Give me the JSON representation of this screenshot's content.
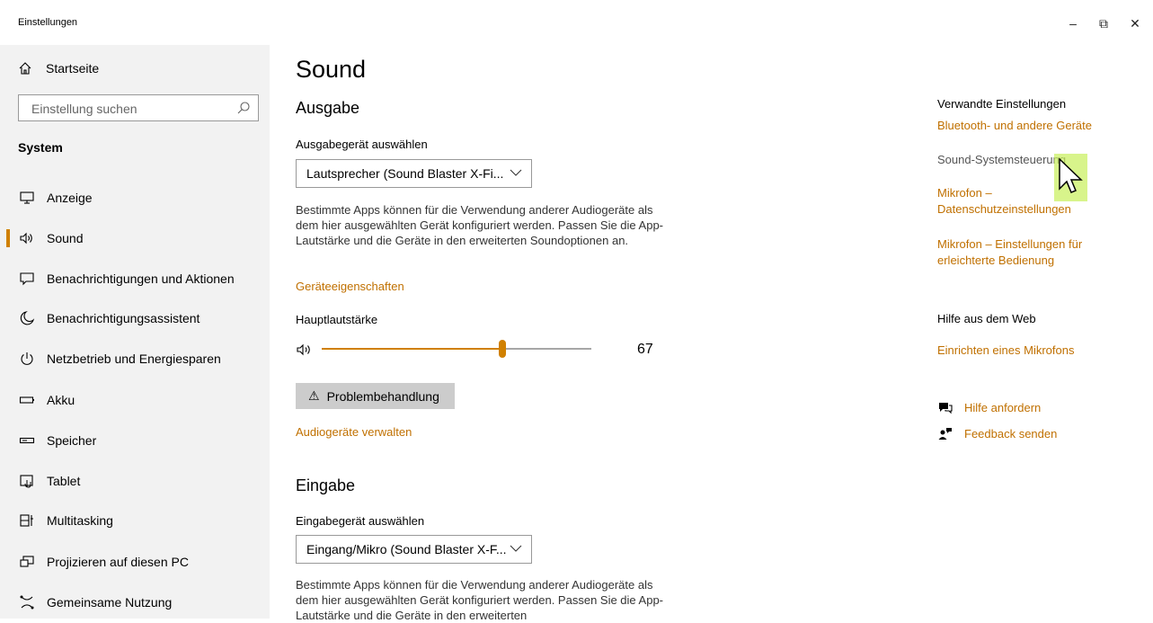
{
  "window": {
    "title": "Einstellungen",
    "minimize": "–",
    "maximize": "⧉",
    "close": "✕"
  },
  "sidebar": {
    "home_label": "Startseite",
    "search_placeholder": "Einstellung suchen",
    "section_heading": "System",
    "items": [
      {
        "label": "Anzeige",
        "icon": "monitor-icon"
      },
      {
        "label": "Sound",
        "icon": "speaker-icon",
        "active": true
      },
      {
        "label": "Benachrichtigungen und Aktionen",
        "icon": "notification-icon"
      },
      {
        "label": "Benachrichtigungsassistent",
        "icon": "moon-icon"
      },
      {
        "label": "Netzbetrieb und Energiesparen",
        "icon": "power-icon"
      },
      {
        "label": "Akku",
        "icon": "battery-icon"
      },
      {
        "label": "Speicher",
        "icon": "storage-icon"
      },
      {
        "label": "Tablet",
        "icon": "tablet-icon"
      },
      {
        "label": "Multitasking",
        "icon": "multitasking-icon"
      },
      {
        "label": "Projizieren auf diesen PC",
        "icon": "project-icon"
      },
      {
        "label": "Gemeinsame Nutzung",
        "icon": "share-icon"
      }
    ]
  },
  "main": {
    "title": "Sound",
    "output": {
      "heading": "Ausgabe",
      "select_label": "Ausgabegerät auswählen",
      "device": "Lautsprecher (Sound Blaster X-Fi...",
      "description": "Bestimmte Apps können für die Verwendung anderer Audiogeräte als dem hier ausgewählten Gerät konfiguriert werden. Passen Sie die App-Lautstärke und die Geräte in den erweiterten Soundoptionen an.",
      "properties_link": "Geräteeigenschaften",
      "volume_label": "Hauptlautstärke",
      "volume_value": "67",
      "volume_fraction": 0.67,
      "troubleshoot_label": "Problembehandlung",
      "manage_link": "Audiogeräte verwalten"
    },
    "input": {
      "heading": "Eingabe",
      "select_label": "Eingabegerät auswählen",
      "device": "Eingang/Mikro (Sound Blaster X-F...",
      "description": "Bestimmte Apps können für die Verwendung anderer Audiogeräte als dem hier ausgewählten Gerät konfiguriert werden. Passen Sie die App-Lautstärke und die Geräte in den erweiterten"
    }
  },
  "related": {
    "heading": "Verwandte Einstellungen",
    "links": {
      "bluetooth": "Bluetooth- und andere Geräte",
      "sound_control": "Sound-Systemsteuerung",
      "mic_privacy": "Mikrofon – Datenschutzeinstellungen",
      "mic_access": "Mikrofon – Einstellungen für erleichterte Bedienung"
    },
    "web_heading": "Hilfe aus dem Web",
    "web_link": "Einrichten eines Mikrofons",
    "get_help": "Hilfe anfordern",
    "feedback": "Feedback senden"
  },
  "colors": {
    "accent": "#c07000",
    "sidebar_bg": "#f2f2f2",
    "slider_track": "#d08000"
  }
}
